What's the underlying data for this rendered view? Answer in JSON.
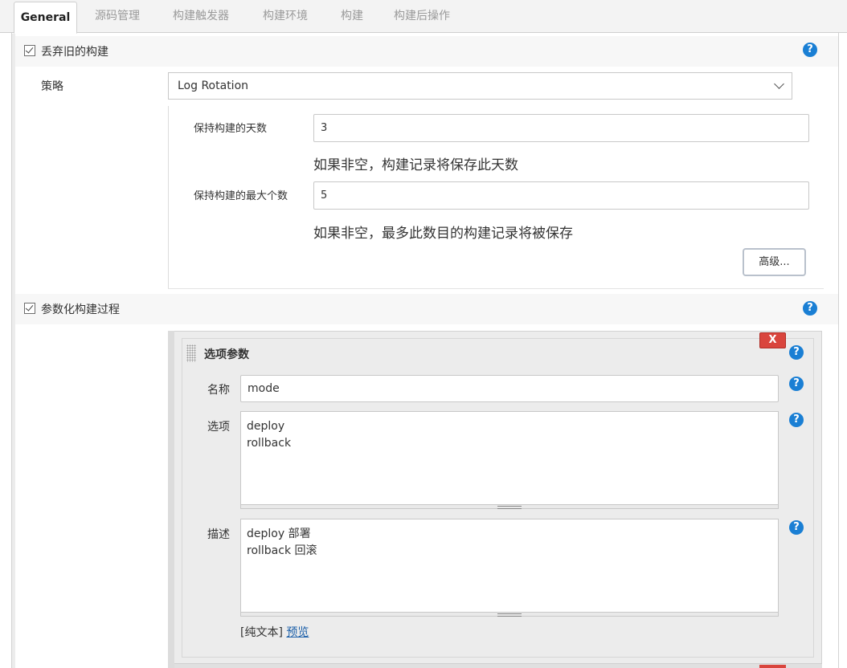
{
  "tabs": [
    {
      "label": "General",
      "active": true
    },
    {
      "label": "源码管理",
      "active": false
    },
    {
      "label": "构建触发器",
      "active": false
    },
    {
      "label": "构建环境",
      "active": false
    },
    {
      "label": "构建",
      "active": false
    },
    {
      "label": "构建后操作",
      "active": false
    }
  ],
  "discard_old": {
    "checkbox_label": "丢弃旧的构建",
    "checked": true,
    "help_icon": "?",
    "strategy_label": "策略",
    "strategy_value": "Log Rotation",
    "days_label": "保持构建的天数",
    "days_value": "3",
    "days_hint": "如果非空，构建记录将保存此天数",
    "max_label": "保持构建的最大个数",
    "max_value": "5",
    "max_hint": "如果非空，最多此数目的构建记录将被保存",
    "advanced_button": "高级..."
  },
  "parameterized": {
    "checkbox_label": "参数化构建过程",
    "checked": true,
    "help_icon": "?"
  },
  "choice_param": {
    "title": "选项参数",
    "delete_button": "X",
    "name_label": "名称",
    "name_value": "mode",
    "choices_label": "选项",
    "choices_value": "deploy\nrollback",
    "description_label": "描述",
    "description_value": "deploy 部署\nrollback 回滚",
    "plain_text": "[纯文本]",
    "preview_link": "预览"
  },
  "colors": {
    "help_blue": "#1a7fd4",
    "delete_red": "#d9453d",
    "link_blue": "#1a5ea8"
  },
  "icons": [
    "help-icon",
    "checkbox-checked-icon",
    "chevron-down-icon",
    "drag-handle-icon",
    "resize-grip-icon"
  ]
}
